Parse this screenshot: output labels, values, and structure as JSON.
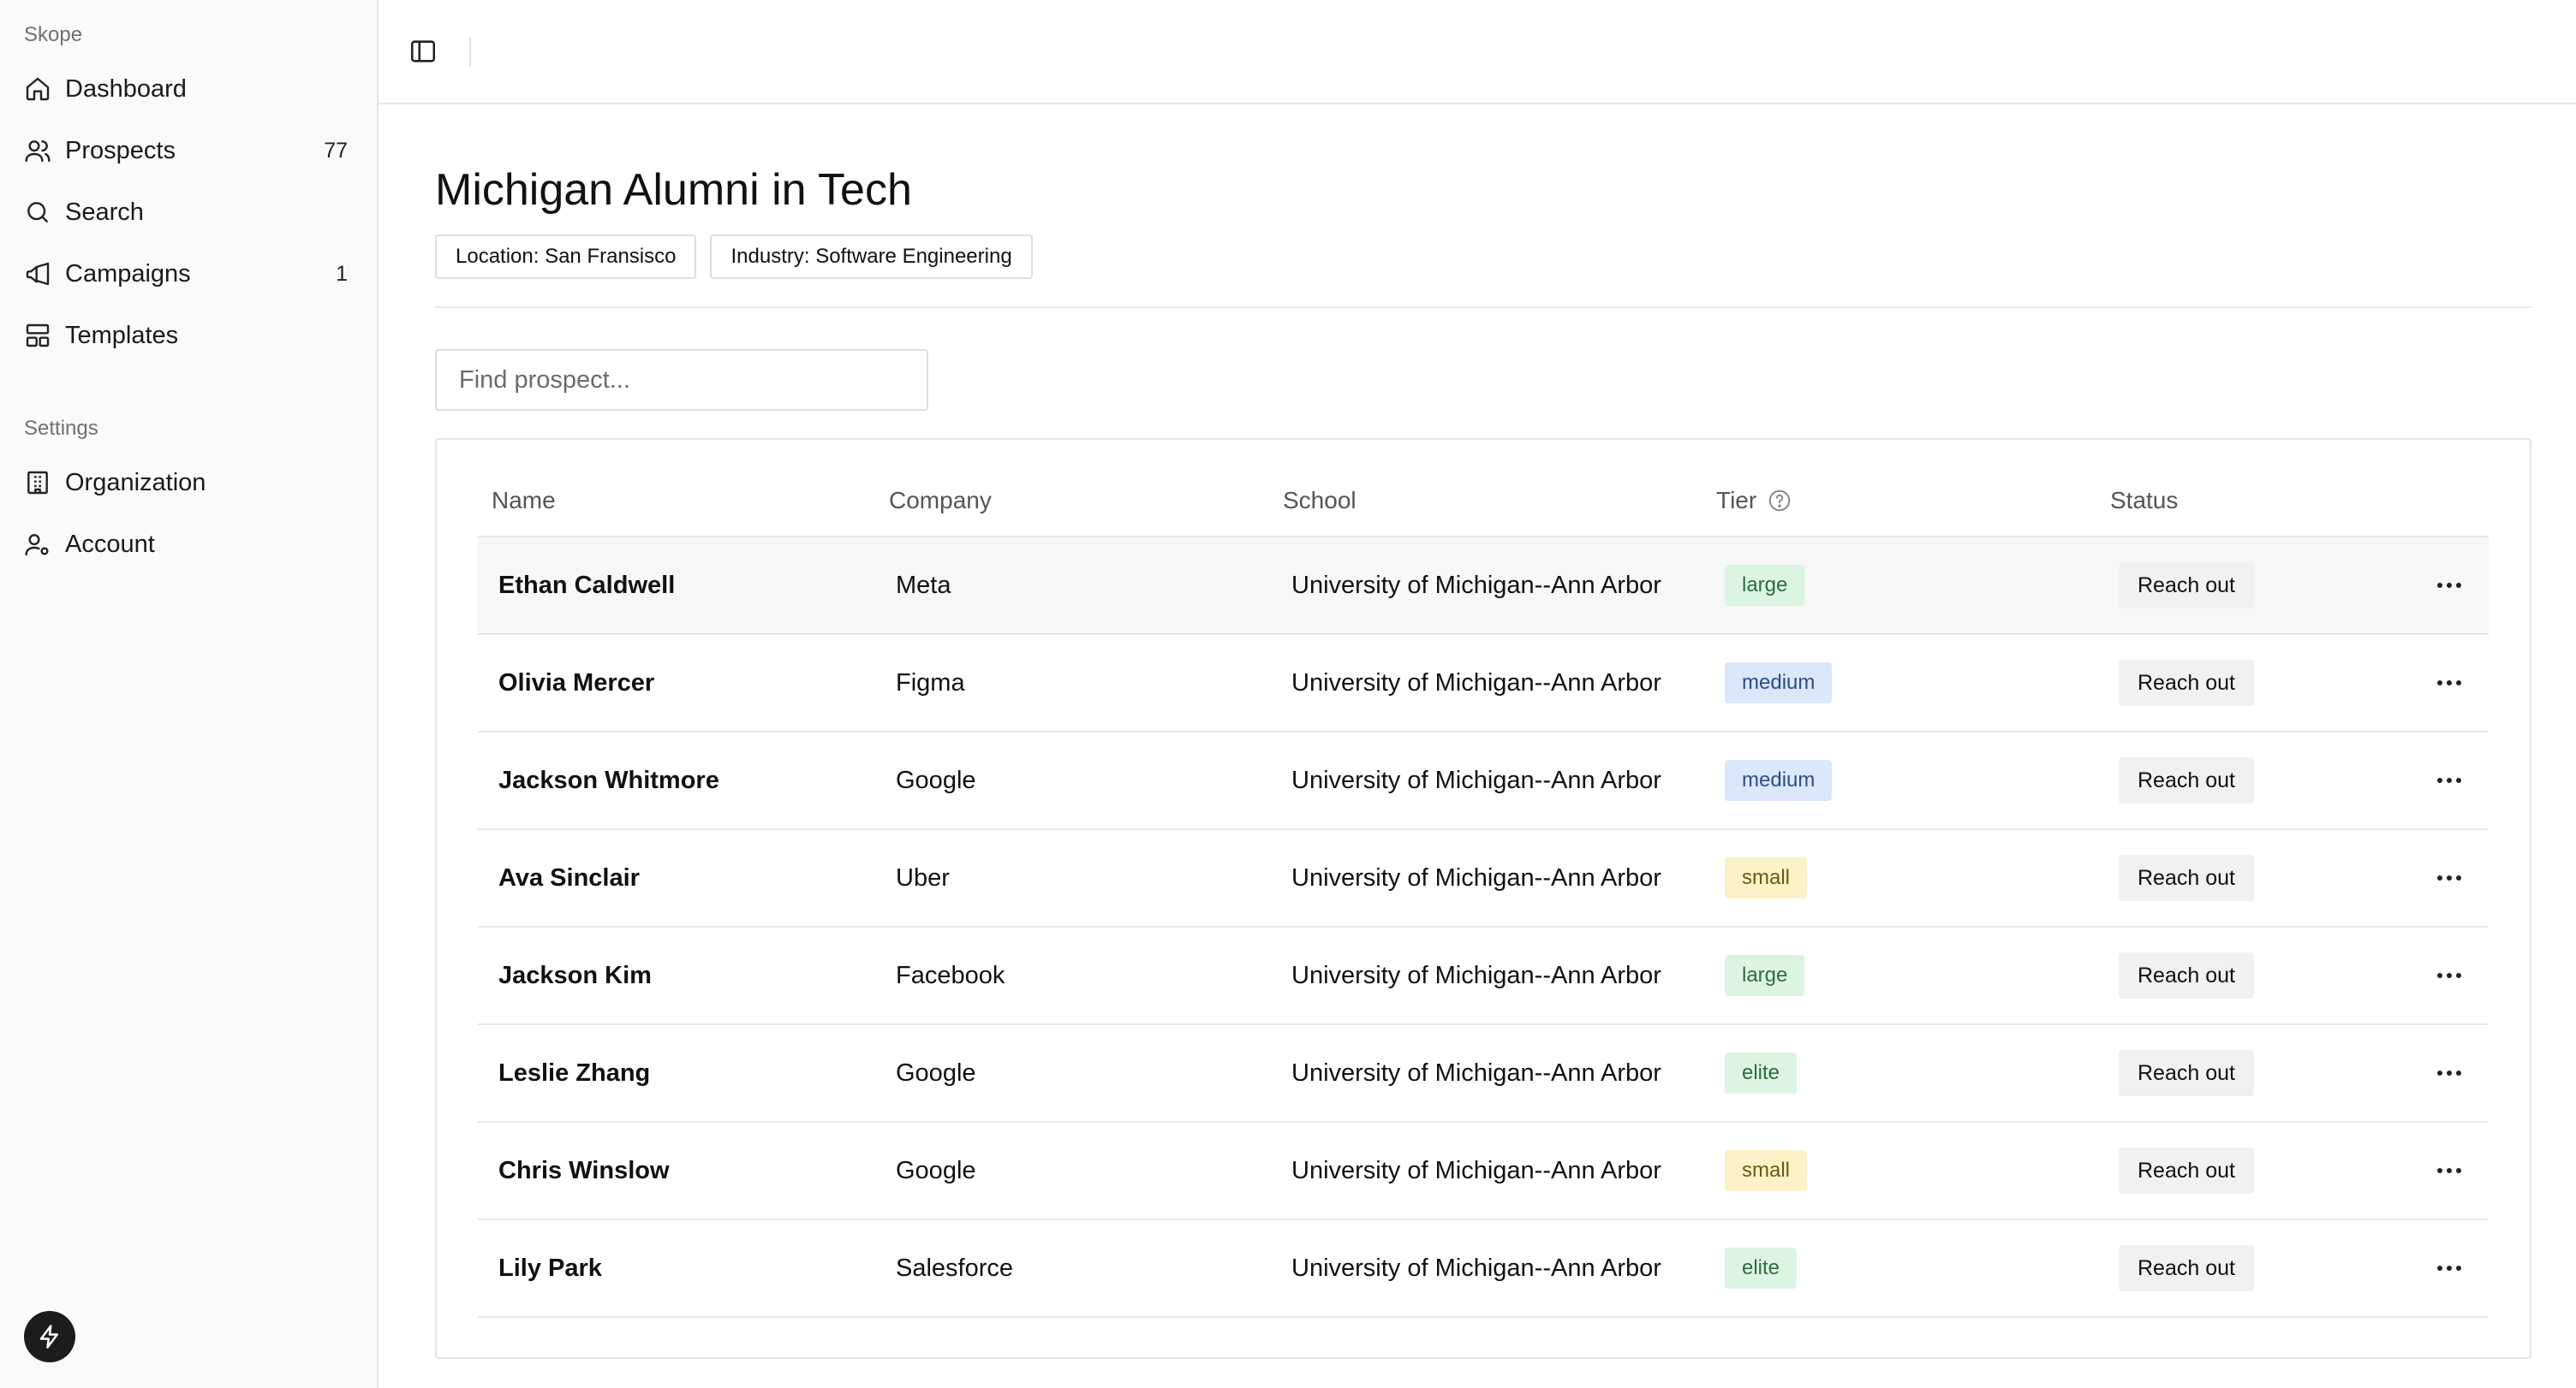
{
  "sidebar": {
    "app_label": "Skope",
    "nav": [
      {
        "label": "Dashboard",
        "icon": "home-icon",
        "count": ""
      },
      {
        "label": "Prospects",
        "icon": "users-icon",
        "count": "77"
      },
      {
        "label": "Search",
        "icon": "search-icon",
        "count": ""
      },
      {
        "label": "Campaigns",
        "icon": "megaphone-icon",
        "count": "1"
      },
      {
        "label": "Templates",
        "icon": "layout-icon",
        "count": ""
      }
    ],
    "settings_label": "Settings",
    "settings": [
      {
        "label": "Organization",
        "icon": "building-icon"
      },
      {
        "label": "Account",
        "icon": "user-cog-icon"
      }
    ]
  },
  "page": {
    "title": "Michigan Alumni in Tech",
    "filters": [
      "Location: San Fransisco",
      "Industry: Software Engineering"
    ],
    "search_placeholder": "Find prospect..."
  },
  "table": {
    "headers": {
      "name": "Name",
      "company": "Company",
      "school": "School",
      "tier": "Tier",
      "status": "Status"
    },
    "rows": [
      {
        "name": "Ethan Caldwell",
        "company": "Meta",
        "school": "University of Michigan--Ann Arbor",
        "tier": "large",
        "status": "Reach out"
      },
      {
        "name": "Olivia Mercer",
        "company": "Figma",
        "school": "University of Michigan--Ann Arbor",
        "tier": "medium",
        "status": "Reach out"
      },
      {
        "name": "Jackson Whitmore",
        "company": "Google",
        "school": "University of Michigan--Ann Arbor",
        "tier": "medium",
        "status": "Reach out"
      },
      {
        "name": "Ava Sinclair",
        "company": "Uber",
        "school": "University of Michigan--Ann Arbor",
        "tier": "small",
        "status": "Reach out"
      },
      {
        "name": "Jackson Kim",
        "company": "Facebook",
        "school": "University of Michigan--Ann Arbor",
        "tier": "large",
        "status": "Reach out"
      },
      {
        "name": "Leslie Zhang",
        "company": "Google",
        "school": "University of Michigan--Ann Arbor",
        "tier": "elite",
        "status": "Reach out"
      },
      {
        "name": "Chris Winslow",
        "company": "Google",
        "school": "University of Michigan--Ann Arbor",
        "tier": "small",
        "status": "Reach out"
      },
      {
        "name": "Lily Park",
        "company": "Salesforce",
        "school": "University of Michigan--Ann Arbor",
        "tier": "elite",
        "status": "Reach out"
      }
    ]
  },
  "colors": {
    "tier_large_bg": "#dcf5e3",
    "tier_medium_bg": "#dbe7fb",
    "tier_small_bg": "#fbf3c7",
    "tier_elite_bg": "#dcf5e3"
  }
}
